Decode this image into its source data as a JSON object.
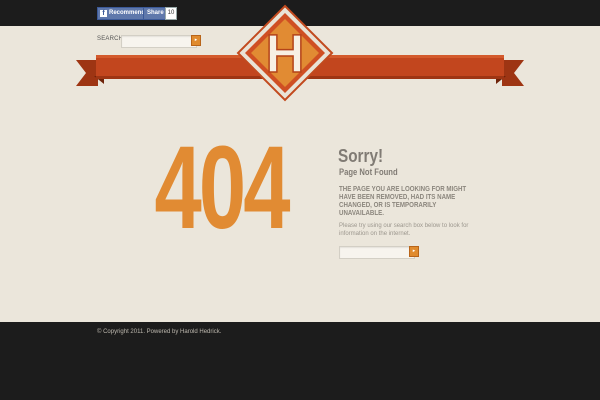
{
  "facebook": {
    "recommend_label": "Recommend",
    "share_label": "Share",
    "share_count": "10",
    "f_glyph": "f"
  },
  "header_search": {
    "label": "SEARCH",
    "placeholder": "",
    "button_glyph": "▸"
  },
  "logo": {
    "letter": "H"
  },
  "error": {
    "code": "404",
    "heading": "Sorry!",
    "subheading": "Page Not Found",
    "message": "THE PAGE YOU ARE LOOKING FOR MIGHT HAVE BEEN REMOVED, HAD ITS NAME CHANGED, OR IS TEMPORARILY UNAVAILABLE.",
    "hint": "Please try using our search box below to look for information on the internet."
  },
  "body_search": {
    "placeholder": "",
    "button_glyph": "▸"
  },
  "footer": {
    "copyright": "© Copyright 2011. Powered by Harold Hedrick."
  },
  "colors": {
    "accent": "#e18b33",
    "ribbon": "#c2461e",
    "topbar": "#1c1c1c",
    "background": "#ebe6db"
  }
}
